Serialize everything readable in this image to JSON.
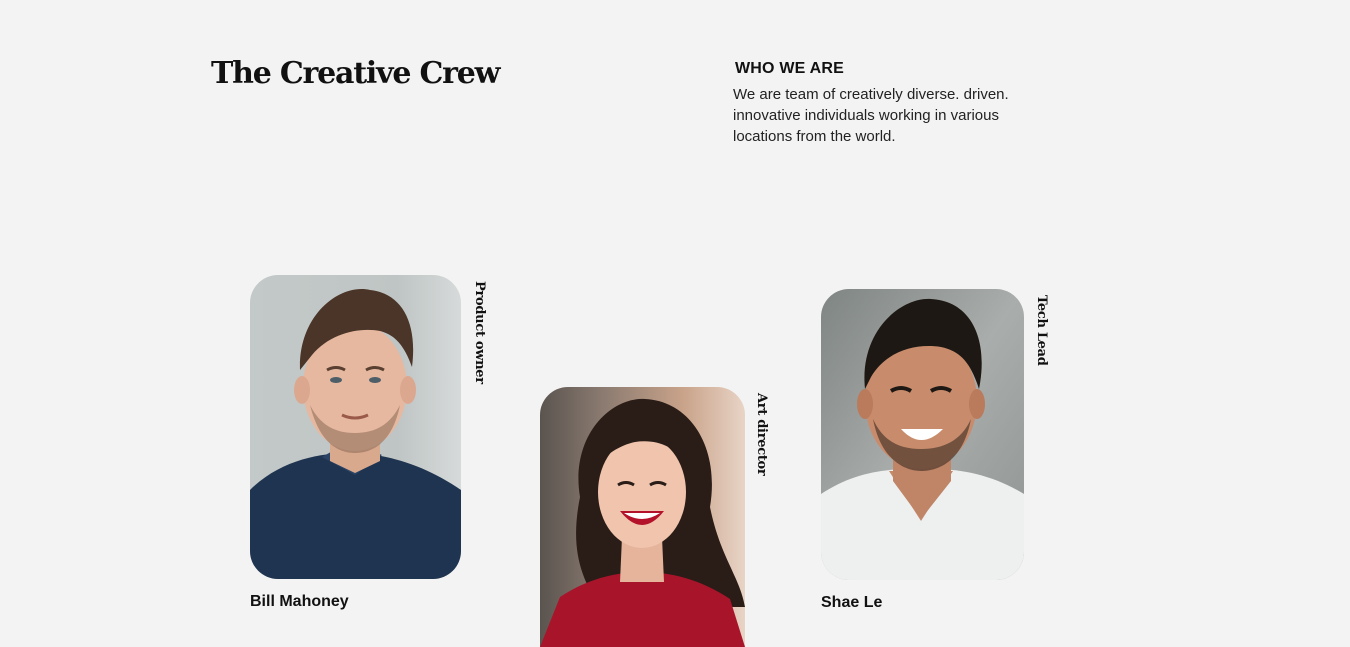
{
  "header": {
    "title": "The Creative Crew"
  },
  "about": {
    "heading": "WHO WE ARE",
    "text": "We are team of creatively diverse. driven. innovative individuals working in various locations from the world."
  },
  "team": [
    {
      "name": "Bill Mahoney",
      "role": "Product owner",
      "photo_icon": "man-portrait-photo"
    },
    {
      "name": "",
      "role": "Art director",
      "photo_icon": "woman-portrait-photo"
    },
    {
      "name": "Shae Le",
      "role": "Tech Lead",
      "photo_icon": "man-portrait-photo"
    }
  ],
  "colors": {
    "background": "#f3f3f3",
    "text": "#111111"
  }
}
